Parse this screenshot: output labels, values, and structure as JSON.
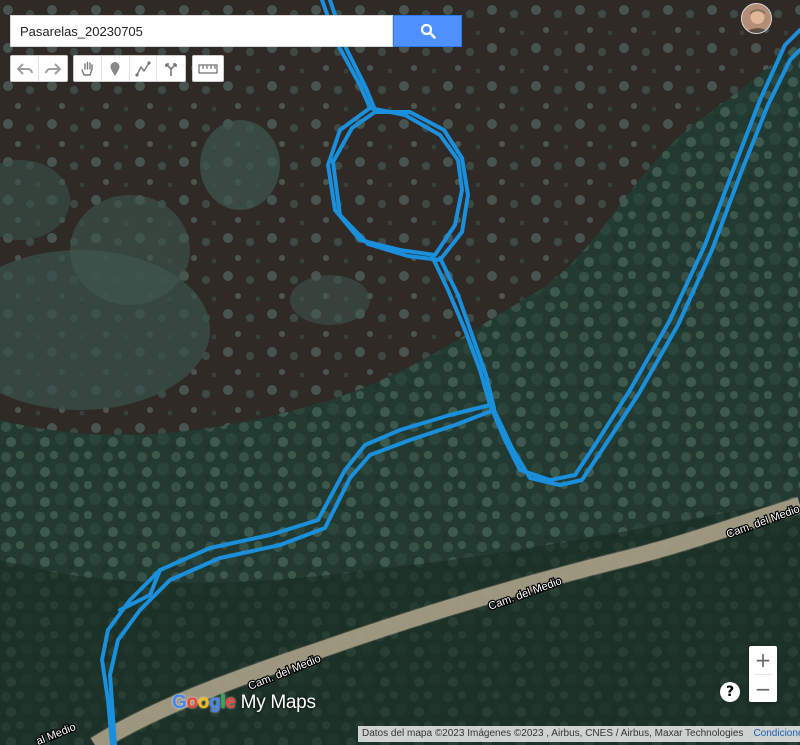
{
  "search": {
    "value": "Pasarelas_20230705",
    "button_icon": "search-icon"
  },
  "toolbar": {
    "undo_icon": "undo-icon",
    "redo_icon": "redo-icon",
    "pan_icon": "hand-icon",
    "marker_icon": "marker-icon",
    "draw_line_icon": "draw-line-icon",
    "directions_icon": "directions-icon",
    "measure_icon": "ruler-icon"
  },
  "map": {
    "road_labels": [
      "Cam. del Medio",
      "Cam. del Medio",
      "Cam. del Medio"
    ],
    "track_color": "#1a8fdc",
    "road_color": "#c8bfa9"
  },
  "logo": {
    "google": "Google",
    "mymaps": "My Maps"
  },
  "attribution": {
    "text": "Datos del mapa ©2023 Imágenes ©2023 , Airbus, CNES / Airbus, Maxar Technologies",
    "terms_link": "Condiciones"
  },
  "controls": {
    "zoom_in": "+",
    "zoom_out": "−",
    "help": "?"
  }
}
